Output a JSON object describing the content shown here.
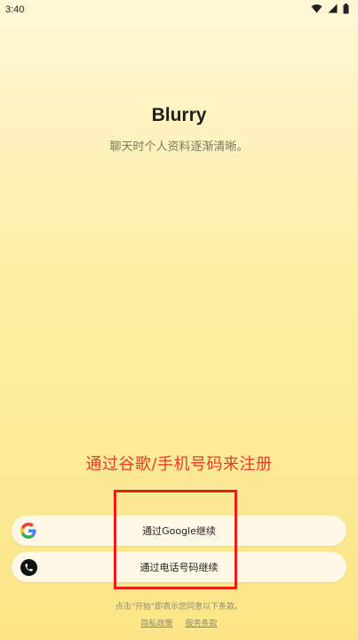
{
  "status_bar": {
    "time": "3:40"
  },
  "app": {
    "title": "Blurry",
    "subtitle": "聊天时个人资料逐渐清晰。"
  },
  "annotation": {
    "text": "通过谷歌/手机号码来注册",
    "color": "#ee3b2b"
  },
  "buttons": {
    "google": {
      "label": "通过Google继续",
      "icon": "google-icon"
    },
    "phone": {
      "label": "通过电话号码继续",
      "icon": "phone-icon"
    }
  },
  "footer": {
    "terms": "点击\"开始\"即表示您同意以下条款。",
    "privacy_link": "隐私政策",
    "service_link": "服务条款"
  },
  "colors": {
    "background_top": "#fff7d6",
    "background_bottom": "#fbe586",
    "button_bg": "#fff8e6",
    "annotation_red": "#e8201a"
  }
}
